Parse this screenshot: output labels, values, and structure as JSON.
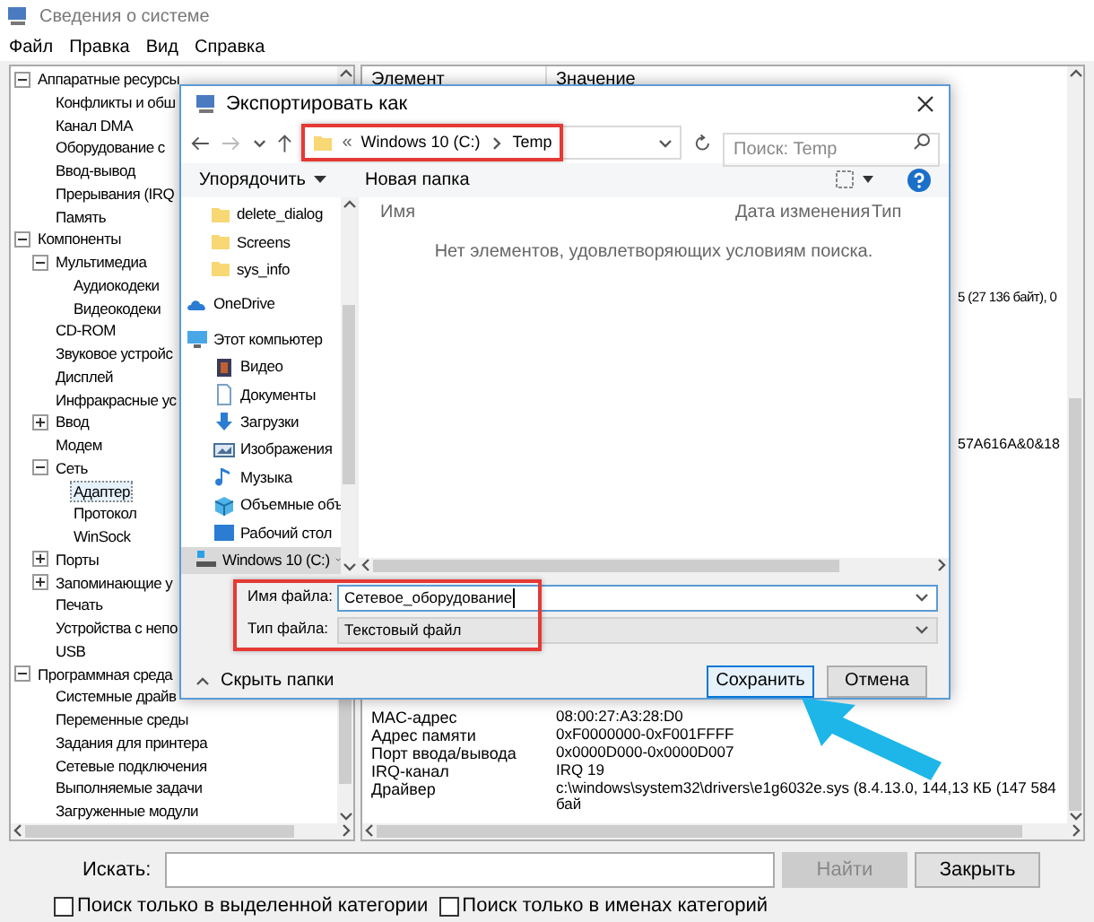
{
  "window": {
    "title": "Сведения о системе"
  },
  "menu": [
    "Файл",
    "Правка",
    "Вид",
    "Справка"
  ],
  "tree": [
    {
      "label": "Аппаратные ресурсы",
      "expanded": true,
      "selected": false,
      "children": [
        {
          "label": "Конфликты и обш",
          "selected": false
        },
        {
          "label": "Канал DMA",
          "selected": false
        },
        {
          "label": "Оборудование с",
          "selected": false
        },
        {
          "label": "Ввод-вывод",
          "selected": false
        },
        {
          "label": "Прерывания (IRQ",
          "selected": false
        },
        {
          "label": "Память",
          "selected": false
        }
      ]
    },
    {
      "label": "Компоненты",
      "expanded": true,
      "selected": false,
      "children": [
        {
          "label": "Мультимедиа",
          "expanded": true,
          "selected": false,
          "children": [
            {
              "label": "Аудиокодеки",
              "selected": false
            },
            {
              "label": "Видеокодеки",
              "selected": false
            }
          ]
        },
        {
          "label": "CD-ROM",
          "selected": false
        },
        {
          "label": "Звуковое устройс",
          "selected": false
        },
        {
          "label": "Дисплей",
          "selected": false
        },
        {
          "label": "Инфракрасные ус",
          "selected": false
        },
        {
          "label": "Ввод",
          "expanded": false,
          "selected": false
        },
        {
          "label": "Модем",
          "selected": false
        },
        {
          "label": "Сеть",
          "expanded": true,
          "selected": false,
          "children": [
            {
              "label": "Адаптер",
              "selected": true
            },
            {
              "label": "Протокол",
              "selected": false
            },
            {
              "label": "WinSock",
              "selected": false
            }
          ]
        },
        {
          "label": "Порты",
          "expanded": false,
          "selected": false
        },
        {
          "label": "Запоминающие у",
          "expanded": false,
          "selected": false
        },
        {
          "label": "Печать",
          "selected": false
        },
        {
          "label": "Устройства с непо",
          "selected": false
        },
        {
          "label": "USB",
          "selected": false
        }
      ]
    },
    {
      "label": "Программная среда",
      "expanded": true,
      "selected": false,
      "children": [
        {
          "label": "Системные драйв",
          "selected": false
        },
        {
          "label": "Переменные среды",
          "selected": false
        },
        {
          "label": "Задания для принтера",
          "selected": false
        },
        {
          "label": "Сетевые подключения",
          "selected": false
        },
        {
          "label": "Выполняемые задачи",
          "selected": false
        },
        {
          "label": "Загруженные модули",
          "selected": false
        }
      ]
    }
  ],
  "details": {
    "columns": [
      "Элемент",
      "Значение"
    ],
    "fragments": [
      "5 (27 136 байт), 0",
      "57A616A&0&18"
    ],
    "rows": [
      {
        "item": "MAC-адрес",
        "value": "08:00:27:A3:28:D0"
      },
      {
        "item": "Адрес памяти",
        "value": "0xF0000000-0xF001FFFF"
      },
      {
        "item": "Порт ввода/вывода",
        "value": "0x0000D000-0x0000D007"
      },
      {
        "item": "IRQ-канал",
        "value": "IRQ 19"
      },
      {
        "item": "Драйвер",
        "value": "c:\\windows\\system32\\drivers\\e1g6032e.sys (8.4.13.0, 144,13 КБ (147 584 бай"
      }
    ]
  },
  "search": {
    "label": "Искать:",
    "find_button": {
      "label": "Найти",
      "disabled": true
    },
    "close_button": "Закрыть",
    "options": [
      {
        "label": "Поиск только в выделенной категории",
        "checked": false
      },
      {
        "label": "Поиск только в именах категорий",
        "checked": false
      }
    ]
  },
  "dialog": {
    "title": "Экспортировать как",
    "path_prefix": "«",
    "path": [
      "Windows 10 (C:)",
      "Temp"
    ],
    "search_placeholder": "Поиск: Temp",
    "organize": "Упорядочить",
    "new_folder": "Новая папка",
    "nav": [
      {
        "label": "delete_dialog",
        "kind": "folder",
        "selected": false
      },
      {
        "label": "Screens",
        "kind": "folder",
        "selected": false
      },
      {
        "label": "sys_info",
        "kind": "folder",
        "selected": false
      },
      {
        "label": "OneDrive",
        "kind": "cloud",
        "selected": false
      },
      {
        "label": "Этот компьютер",
        "kind": "computer",
        "selected": false
      },
      {
        "label": "Видео",
        "kind": "video",
        "selected": false
      },
      {
        "label": "Документы",
        "kind": "document",
        "selected": false
      },
      {
        "label": "Загрузки",
        "kind": "download",
        "selected": false
      },
      {
        "label": "Изображения",
        "kind": "image",
        "selected": false
      },
      {
        "label": "Музыка",
        "kind": "music",
        "selected": false
      },
      {
        "label": "Объемные объ",
        "kind": "cube",
        "selected": false
      },
      {
        "label": "Рабочий стол",
        "kind": "desktop",
        "selected": false
      },
      {
        "label": "Windows 10 (C:)",
        "kind": "drive",
        "selected": true
      }
    ],
    "columns": [
      "Имя",
      "Дата изменения",
      "Тип"
    ],
    "empty_message": "Нет элементов, удовлетворяющих условиям поиска.",
    "file_name": {
      "label": "Имя файла:",
      "value": "Сетевое_оборудование"
    },
    "file_type": {
      "label": "Тип файла:",
      "value": "Текстовый файл"
    },
    "hide_folders": "Скрыть папки",
    "save": "Сохранить",
    "cancel": "Отмена"
  }
}
